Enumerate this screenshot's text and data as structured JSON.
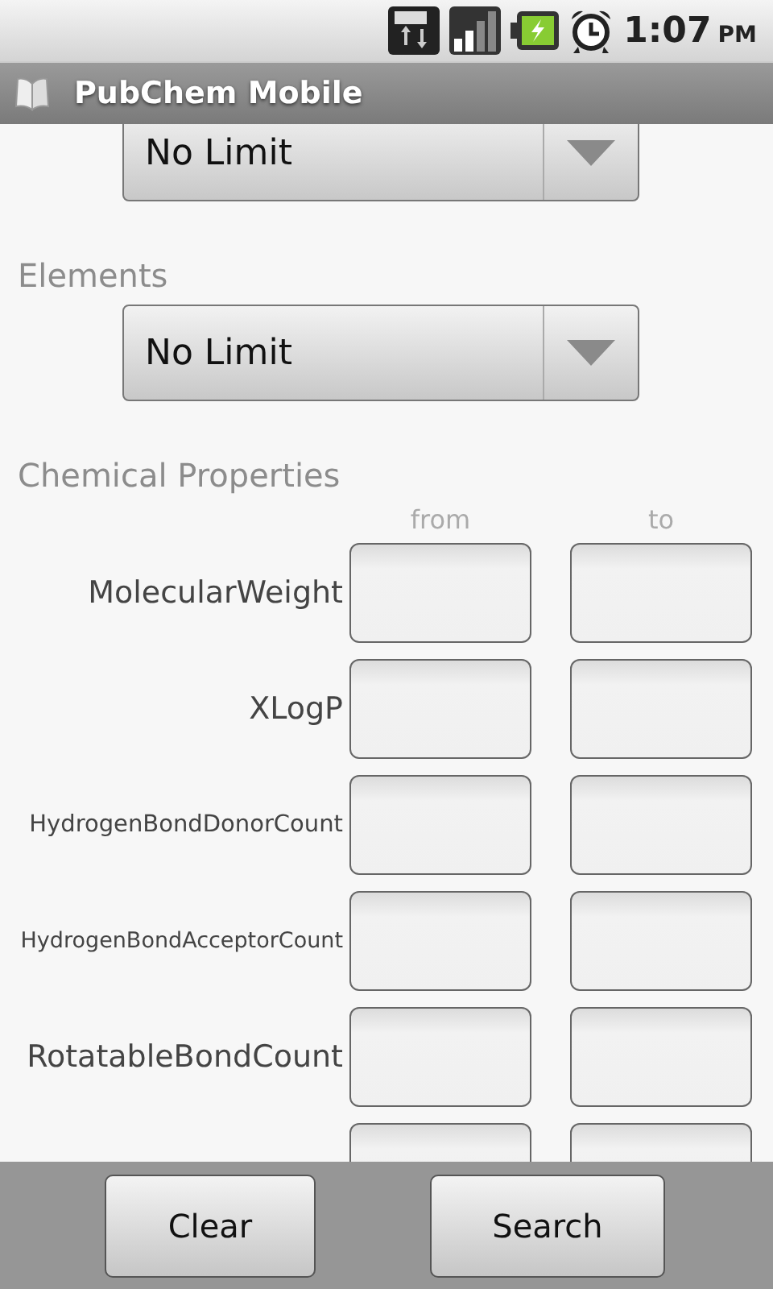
{
  "status_bar": {
    "time": "1:07",
    "ampm": "PM"
  },
  "title_bar": {
    "title": "PubChem Mobile"
  },
  "top_spinner": {
    "value": "No Limit"
  },
  "elements": {
    "label": "Elements",
    "value": "No Limit"
  },
  "chemical_properties": {
    "label": "Chemical Properties",
    "columns": [
      "from",
      "to"
    ],
    "rows": [
      {
        "label": "MolecularWeight"
      },
      {
        "label": "XLogP"
      },
      {
        "label": "HydrogenBondDonorCount"
      },
      {
        "label": "HydrogenBondAcceptorCount"
      },
      {
        "label": "RotatableBondCount"
      },
      {}
    ]
  },
  "buttons": [
    "Clear",
    "Search"
  ]
}
